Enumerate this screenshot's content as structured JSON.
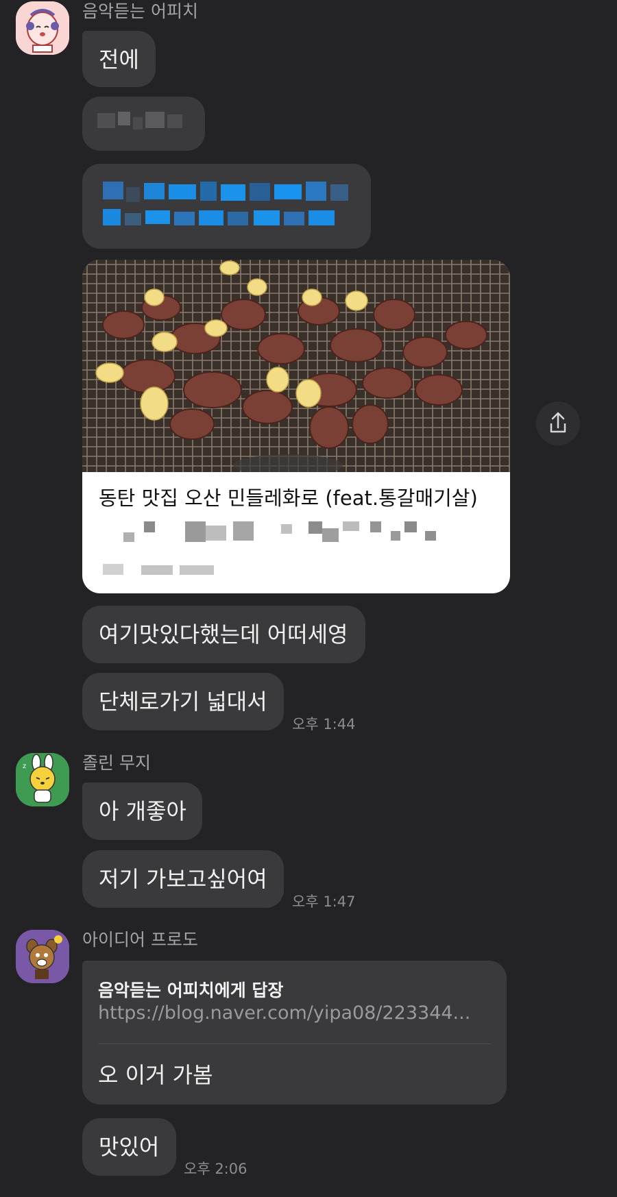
{
  "messages": {
    "group1": {
      "sender": "음악듣는 어피치",
      "texts": [
        "전에",
        "여기맛있다했는데 어떠세영",
        "단체로가기 넓대서"
      ],
      "time": "오후 1:44"
    },
    "link_card": {
      "title": "동탄 맛집 오산 민들레화로 (feat.통갈매기살)"
    },
    "group2": {
      "sender": "졸린 무지",
      "texts": [
        "아 개좋아",
        "저기 가보고싶어여"
      ],
      "time": "오후 1:47"
    },
    "group3": {
      "sender": "아이디어 프로도",
      "reply_to": "음악듣는 어피치에게 답장",
      "reply_link": "https://blog.naver.com/yipa08/223344...",
      "reply_text": "오 이거 가봄",
      "texts": [
        "맛있어"
      ],
      "time": "오후 2:06"
    }
  },
  "icons": {
    "share": "share-icon",
    "avatar1": "apeach-avatar",
    "avatar2": "muzi-avatar",
    "avatar3": "frodo-avatar"
  },
  "colors": {
    "background": "#232326",
    "bubble": "#3a3a3d",
    "avatar1_bg": "#f9d6d4",
    "avatar2_bg": "#3f9a52",
    "avatar3_bg": "#7a58a8"
  }
}
